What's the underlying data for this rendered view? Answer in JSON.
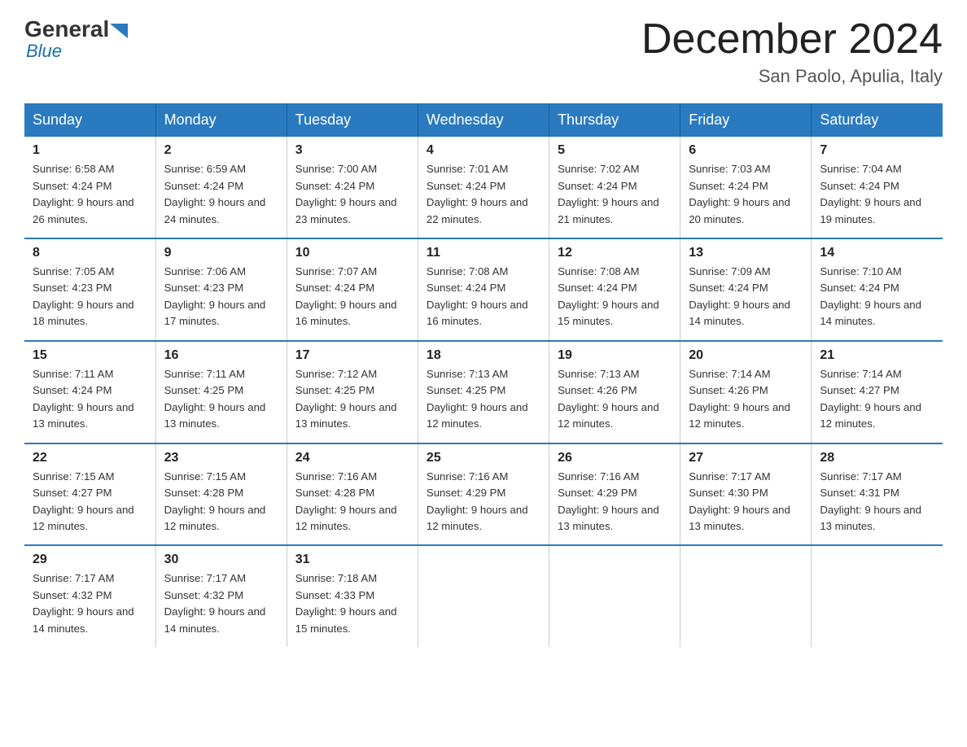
{
  "header": {
    "logo": {
      "general": "General",
      "blue": "Blue"
    },
    "title": "December 2024",
    "location": "San Paolo, Apulia, Italy"
  },
  "days_of_week": [
    "Sunday",
    "Monday",
    "Tuesday",
    "Wednesday",
    "Thursday",
    "Friday",
    "Saturday"
  ],
  "weeks": [
    [
      {
        "day": "1",
        "sunrise": "6:58 AM",
        "sunset": "4:24 PM",
        "daylight": "9 hours and 26 minutes."
      },
      {
        "day": "2",
        "sunrise": "6:59 AM",
        "sunset": "4:24 PM",
        "daylight": "9 hours and 24 minutes."
      },
      {
        "day": "3",
        "sunrise": "7:00 AM",
        "sunset": "4:24 PM",
        "daylight": "9 hours and 23 minutes."
      },
      {
        "day": "4",
        "sunrise": "7:01 AM",
        "sunset": "4:24 PM",
        "daylight": "9 hours and 22 minutes."
      },
      {
        "day": "5",
        "sunrise": "7:02 AM",
        "sunset": "4:24 PM",
        "daylight": "9 hours and 21 minutes."
      },
      {
        "day": "6",
        "sunrise": "7:03 AM",
        "sunset": "4:24 PM",
        "daylight": "9 hours and 20 minutes."
      },
      {
        "day": "7",
        "sunrise": "7:04 AM",
        "sunset": "4:24 PM",
        "daylight": "9 hours and 19 minutes."
      }
    ],
    [
      {
        "day": "8",
        "sunrise": "7:05 AM",
        "sunset": "4:23 PM",
        "daylight": "9 hours and 18 minutes."
      },
      {
        "day": "9",
        "sunrise": "7:06 AM",
        "sunset": "4:23 PM",
        "daylight": "9 hours and 17 minutes."
      },
      {
        "day": "10",
        "sunrise": "7:07 AM",
        "sunset": "4:24 PM",
        "daylight": "9 hours and 16 minutes."
      },
      {
        "day": "11",
        "sunrise": "7:08 AM",
        "sunset": "4:24 PM",
        "daylight": "9 hours and 16 minutes."
      },
      {
        "day": "12",
        "sunrise": "7:08 AM",
        "sunset": "4:24 PM",
        "daylight": "9 hours and 15 minutes."
      },
      {
        "day": "13",
        "sunrise": "7:09 AM",
        "sunset": "4:24 PM",
        "daylight": "9 hours and 14 minutes."
      },
      {
        "day": "14",
        "sunrise": "7:10 AM",
        "sunset": "4:24 PM",
        "daylight": "9 hours and 14 minutes."
      }
    ],
    [
      {
        "day": "15",
        "sunrise": "7:11 AM",
        "sunset": "4:24 PM",
        "daylight": "9 hours and 13 minutes."
      },
      {
        "day": "16",
        "sunrise": "7:11 AM",
        "sunset": "4:25 PM",
        "daylight": "9 hours and 13 minutes."
      },
      {
        "day": "17",
        "sunrise": "7:12 AM",
        "sunset": "4:25 PM",
        "daylight": "9 hours and 13 minutes."
      },
      {
        "day": "18",
        "sunrise": "7:13 AM",
        "sunset": "4:25 PM",
        "daylight": "9 hours and 12 minutes."
      },
      {
        "day": "19",
        "sunrise": "7:13 AM",
        "sunset": "4:26 PM",
        "daylight": "9 hours and 12 minutes."
      },
      {
        "day": "20",
        "sunrise": "7:14 AM",
        "sunset": "4:26 PM",
        "daylight": "9 hours and 12 minutes."
      },
      {
        "day": "21",
        "sunrise": "7:14 AM",
        "sunset": "4:27 PM",
        "daylight": "9 hours and 12 minutes."
      }
    ],
    [
      {
        "day": "22",
        "sunrise": "7:15 AM",
        "sunset": "4:27 PM",
        "daylight": "9 hours and 12 minutes."
      },
      {
        "day": "23",
        "sunrise": "7:15 AM",
        "sunset": "4:28 PM",
        "daylight": "9 hours and 12 minutes."
      },
      {
        "day": "24",
        "sunrise": "7:16 AM",
        "sunset": "4:28 PM",
        "daylight": "9 hours and 12 minutes."
      },
      {
        "day": "25",
        "sunrise": "7:16 AM",
        "sunset": "4:29 PM",
        "daylight": "9 hours and 12 minutes."
      },
      {
        "day": "26",
        "sunrise": "7:16 AM",
        "sunset": "4:29 PM",
        "daylight": "9 hours and 13 minutes."
      },
      {
        "day": "27",
        "sunrise": "7:17 AM",
        "sunset": "4:30 PM",
        "daylight": "9 hours and 13 minutes."
      },
      {
        "day": "28",
        "sunrise": "7:17 AM",
        "sunset": "4:31 PM",
        "daylight": "9 hours and 13 minutes."
      }
    ],
    [
      {
        "day": "29",
        "sunrise": "7:17 AM",
        "sunset": "4:32 PM",
        "daylight": "9 hours and 14 minutes."
      },
      {
        "day": "30",
        "sunrise": "7:17 AM",
        "sunset": "4:32 PM",
        "daylight": "9 hours and 14 minutes."
      },
      {
        "day": "31",
        "sunrise": "7:18 AM",
        "sunset": "4:33 PM",
        "daylight": "9 hours and 15 minutes."
      },
      null,
      null,
      null,
      null
    ]
  ],
  "labels": {
    "sunrise_prefix": "Sunrise: ",
    "sunset_prefix": "Sunset: ",
    "daylight_prefix": "Daylight: "
  }
}
